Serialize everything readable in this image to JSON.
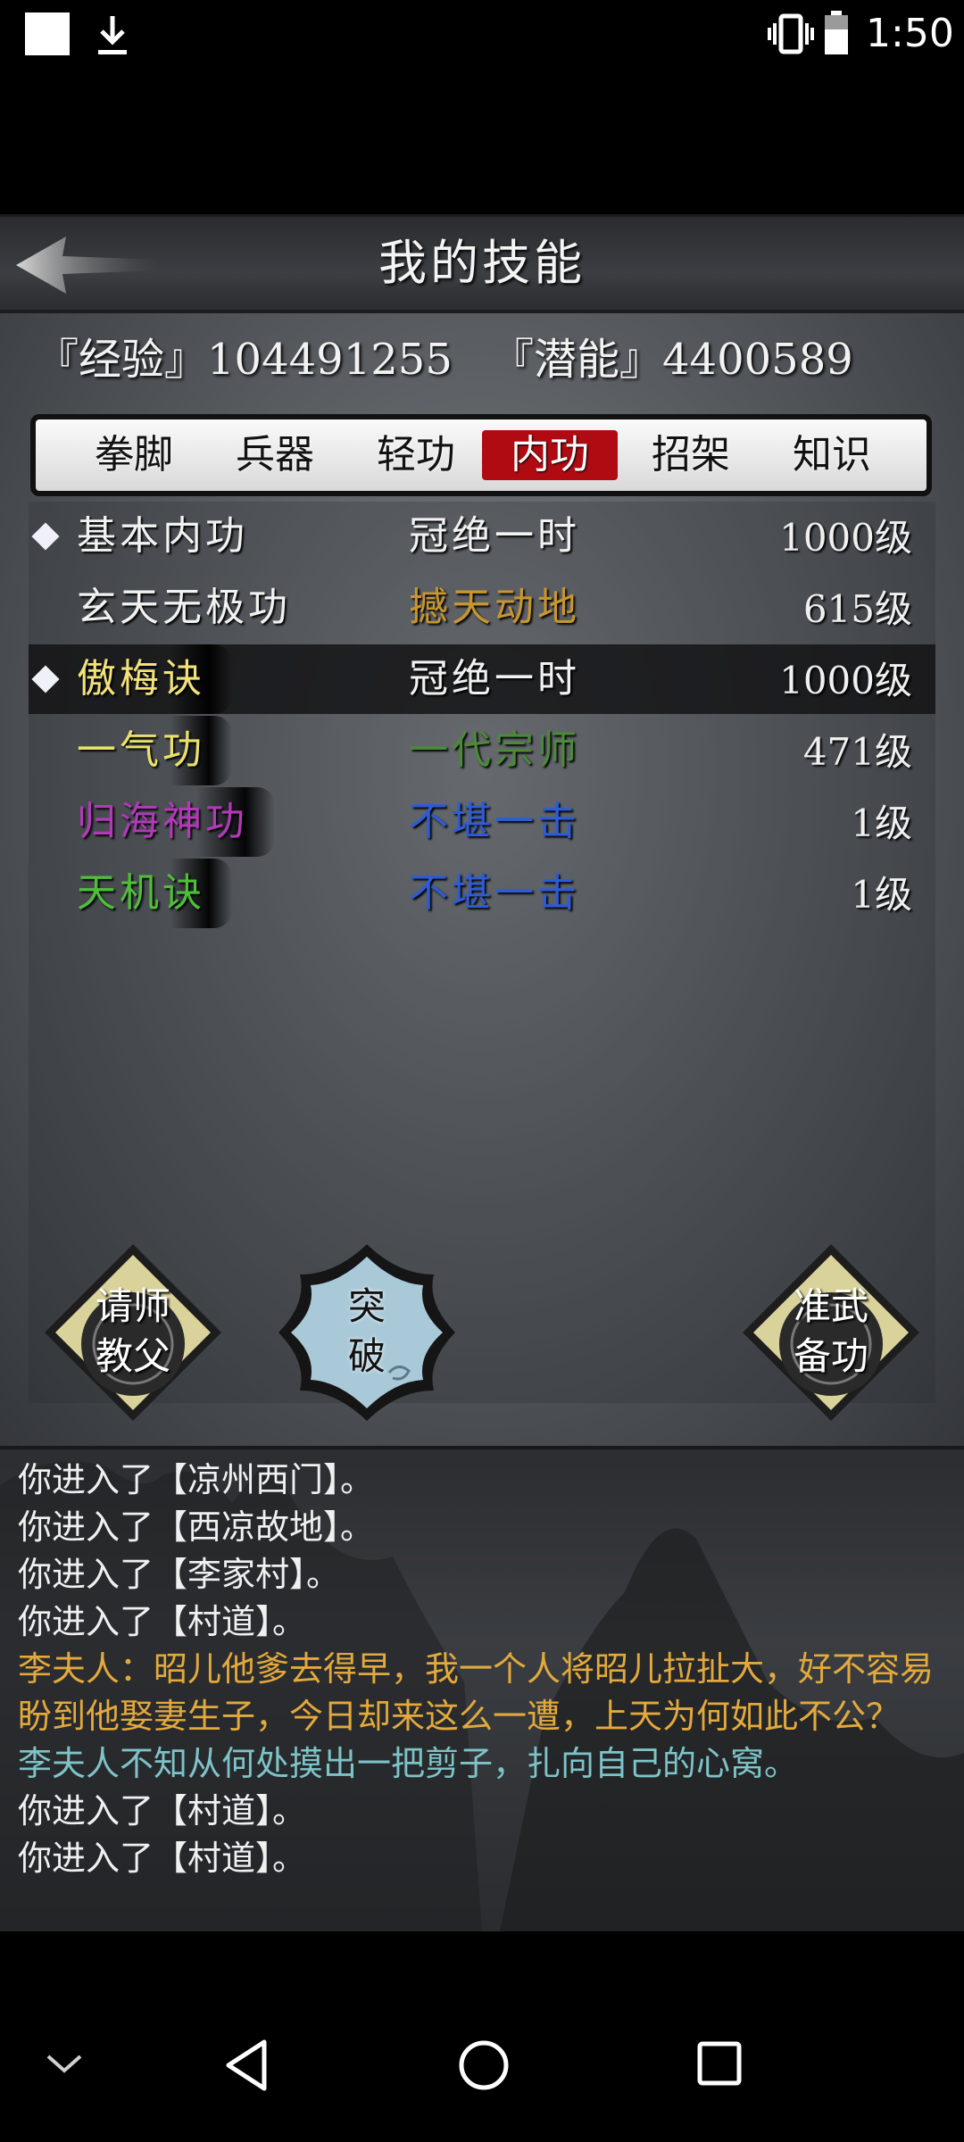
{
  "status_bar": {
    "time": "1:50",
    "icons": [
      "notification-square-icon",
      "download-icon",
      "vibrate-icon",
      "battery-icon"
    ]
  },
  "header": {
    "title": "我的技能",
    "back_icon": "back-arrow-icon"
  },
  "stats": {
    "experience": "『经验』104491255",
    "potential": "『潜能』4400589"
  },
  "tabs": [
    {
      "label": "拳脚",
      "active": false
    },
    {
      "label": "兵器",
      "active": false
    },
    {
      "label": "轻功",
      "active": false
    },
    {
      "label": "内功",
      "active": true
    },
    {
      "label": "招架",
      "active": false
    },
    {
      "label": "知识",
      "active": false
    }
  ],
  "skills": [
    {
      "name": "基本内功",
      "rank": "冠绝一时",
      "level": "1000级",
      "marked": true,
      "selected": false,
      "name_color": "#f2f2f2",
      "rank_color": "#f2f2f2"
    },
    {
      "name": "玄天无极功",
      "rank": "撼天动地",
      "level": "615级",
      "marked": false,
      "selected": false,
      "name_color": "#f2f2f2",
      "rank_color": "#c8962e"
    },
    {
      "name": "傲梅诀",
      "rank": "冠绝一时",
      "level": "1000级",
      "marked": true,
      "selected": true,
      "name_color": "#f2e27a",
      "rank_color": "#f2f2f2"
    },
    {
      "name": "一气功",
      "rank": "一代宗师",
      "level": "471级",
      "marked": false,
      "selected": false,
      "name_color": "#e9e26a",
      "rank_color": "#4c8a3a"
    },
    {
      "name": "归海神功",
      "rank": "不堪一击",
      "level": "1级",
      "marked": false,
      "selected": false,
      "name_color": "#b23ab8",
      "rank_color": "#2e5bd6"
    },
    {
      "name": "天机诀",
      "rank": "不堪一击",
      "level": "1级",
      "marked": false,
      "selected": false,
      "name_color": "#4fbf3a",
      "rank_color": "#2e5bd6"
    }
  ],
  "buttons": {
    "teacher": "请师\n教父",
    "breakthrough": "突\n破",
    "prepare": "准武\n备功"
  },
  "log": [
    {
      "text": "你进入了【凉州西门】。",
      "color": "white"
    },
    {
      "text": "你进入了【西凉故地】。",
      "color": "white"
    },
    {
      "text": "你进入了【李家村】。",
      "color": "white"
    },
    {
      "text": "你进入了【村道】。",
      "color": "white"
    },
    {
      "text": "李夫人：昭儿他爹去得早，我一个人将昭儿拉扯大，好不容易盼到他娶妻生子，今日却来这么一遭，上天为何如此不公？",
      "color": "gold"
    },
    {
      "text": "李夫人不知从何处摸出一把剪子，扎向自己的心窝。",
      "color": "teal"
    },
    {
      "text": "你进入了【村道】。",
      "color": "white"
    },
    {
      "text": "你进入了【村道】。",
      "color": "white"
    }
  ],
  "nav": [
    "chevron-down-icon",
    "back-triangle-icon",
    "home-circle-icon",
    "recents-square-icon"
  ]
}
